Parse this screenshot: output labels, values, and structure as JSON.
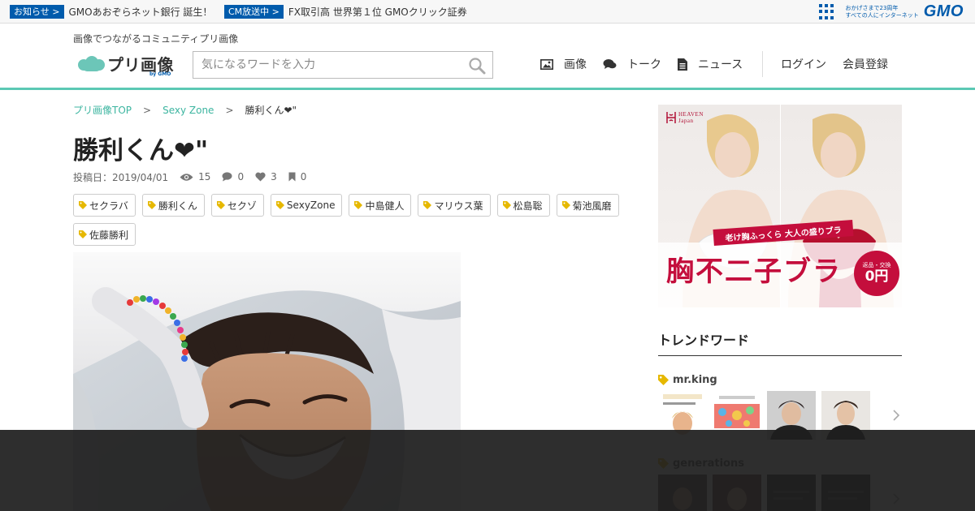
{
  "gmo_bar": {
    "items": [
      {
        "tag": "お知らせ >",
        "text": "GMOあおぞらネット銀行 誕生！"
      },
      {
        "tag": "CM放送中 >",
        "text": "FX取引高 世界第１位 GMOクリック証券"
      }
    ],
    "tagline_line1": "おかげさまで23周年",
    "tagline_line2": "すべての人にインターネット",
    "logo_text": "GMO"
  },
  "header": {
    "tagline": "画像でつながるコミュニティプリ画像",
    "logo_text": "プリ画像",
    "logo_by": "by GMO",
    "search_placeholder": "気になるワードを入力",
    "nav": [
      {
        "icon": "image-icon",
        "label": "画像"
      },
      {
        "icon": "chat-bubble-icon",
        "label": "トーク"
      },
      {
        "icon": "news-document-icon",
        "label": "ニュース"
      }
    ],
    "login": "ログイン",
    "register": "会員登録"
  },
  "breadcrumb": {
    "items": [
      "プリ画像TOP",
      "Sexy Zone"
    ],
    "separator": ">",
    "current": "勝利くん❤\""
  },
  "post": {
    "title": "勝利くん❤\"",
    "posted_label": "投稿日：2019/04/01",
    "views": "15",
    "comments": "0",
    "likes": "3",
    "bookmarks": "0",
    "tags": [
      "セクラバ",
      "勝利くん",
      "セクゾ",
      "SexyZone",
      "中島健人",
      "マリウス葉",
      "松島聡",
      "菊池風磨",
      "佐藤勝利"
    ]
  },
  "ad": {
    "brand_line1": "HEAVEN",
    "brand_line2": "Japan",
    "ribbon": "老け胸ふっくら 大人の盛りブラ",
    "headline": "胸不二子ブラ",
    "badge_top": "返品・交換",
    "badge_main": "0円"
  },
  "trend": {
    "title": "トレンドワード",
    "groups": [
      {
        "word": "mr.king"
      },
      {
        "word": "generations"
      }
    ]
  },
  "colors": {
    "accent": "#5bc8b4",
    "link": "#3cb5a0",
    "gmo_blue": "#005bac",
    "tag_icon": "#e6b800",
    "ad_red": "#c40e3c"
  }
}
